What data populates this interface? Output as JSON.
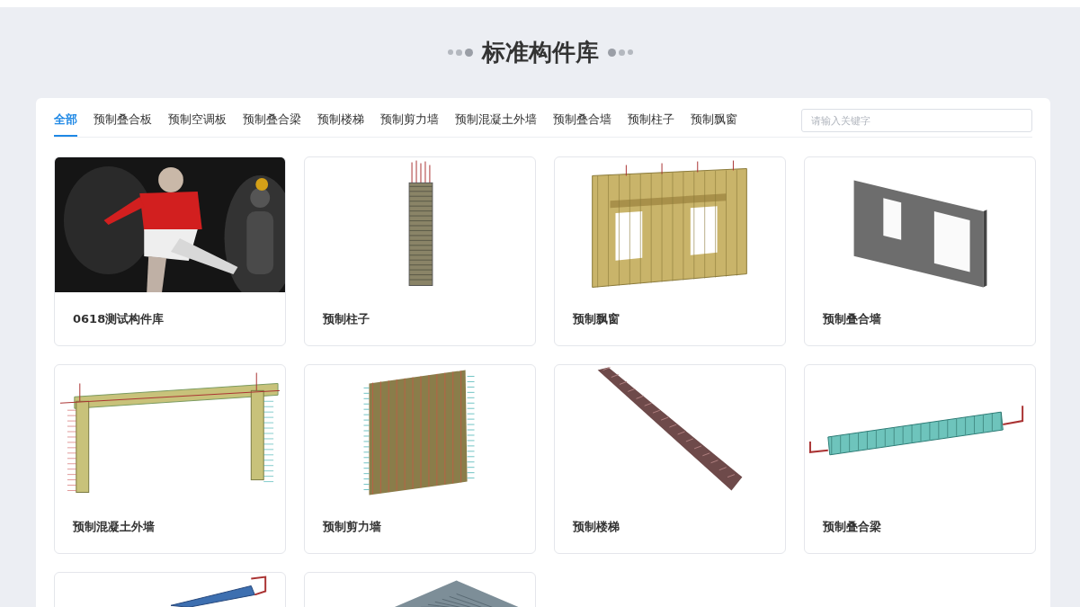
{
  "page_title": "标准构件库",
  "tabs": [
    {
      "label": "全部",
      "selected": true
    },
    {
      "label": "预制叠合板",
      "selected": false
    },
    {
      "label": "预制空调板",
      "selected": false
    },
    {
      "label": "预制叠合梁",
      "selected": false
    },
    {
      "label": "预制楼梯",
      "selected": false
    },
    {
      "label": "预制剪力墙",
      "selected": false
    },
    {
      "label": "预制混凝土外墙",
      "selected": false
    },
    {
      "label": "预制叠合墙",
      "selected": false
    },
    {
      "label": "预制柱子",
      "selected": false
    },
    {
      "label": "预制飘窗",
      "selected": false
    }
  ],
  "search": {
    "placeholder": "请输入关键字"
  },
  "cards": [
    {
      "kind": "picture",
      "title": "0618测试构件库"
    },
    {
      "kind": "column",
      "title": "预制柱子"
    },
    {
      "kind": "bay-window",
      "title": "预制飘窗"
    },
    {
      "kind": "wall-panel",
      "title": "预制叠合墙"
    },
    {
      "kind": "frame-wall",
      "title": "预制混凝土外墙"
    },
    {
      "kind": "shear-wall",
      "title": "预制剪力墙"
    },
    {
      "kind": "stair",
      "title": "预制楼梯"
    },
    {
      "kind": "beam",
      "title": "预制叠合梁"
    },
    {
      "kind": "blue-beam"
    },
    {
      "kind": "slab"
    }
  ]
}
